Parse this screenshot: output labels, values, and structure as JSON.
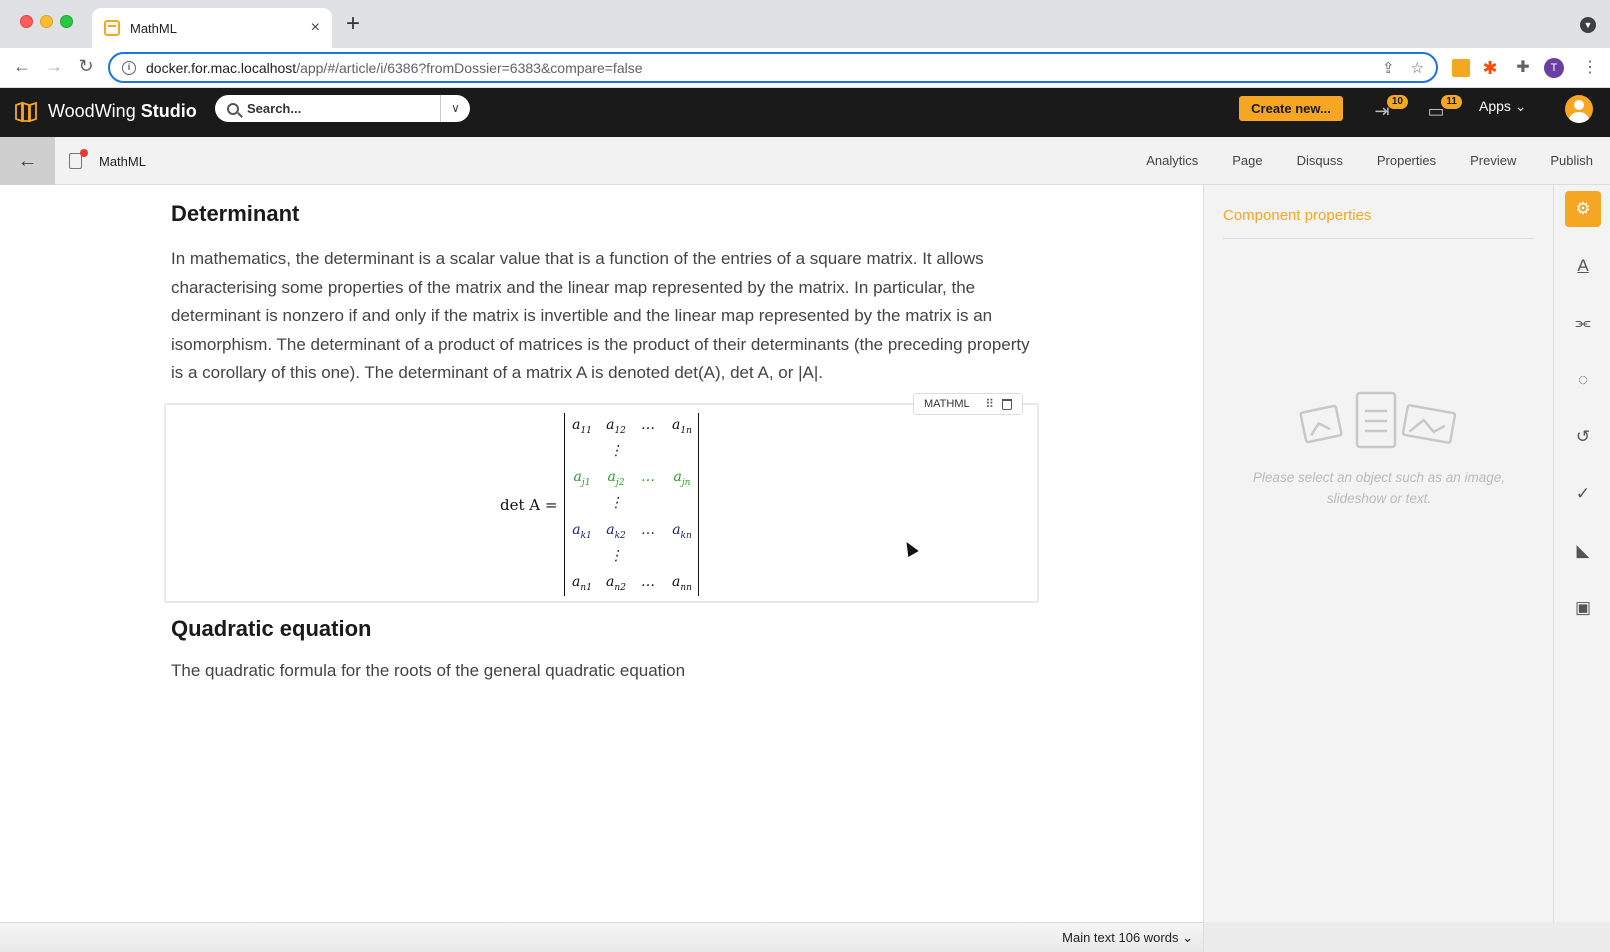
{
  "browser": {
    "tab_title": "MathML",
    "url_host": "docker.for.mac.localhost",
    "url_path": "/app/#/article/i/6386?fromDossier=6383&compare=false",
    "profile_initial": "T"
  },
  "app": {
    "brand_regular": "WoodWing",
    "brand_bold": "Studio",
    "search_placeholder": "Search...",
    "create_label": "Create new...",
    "export_count": "10",
    "inbox_count": "11",
    "apps_label": "Apps"
  },
  "subheader": {
    "doc_name": "MathML",
    "tabs": [
      "Analytics",
      "Page",
      "Disquss",
      "Properties",
      "Preview",
      "Publish"
    ]
  },
  "article": {
    "heading1": "Determinant",
    "paragraph1": "In mathematics, the determinant is a scalar value that is a function of the entries of a square matrix. It allows characterising some properties of the matrix and the linear map represented by the matrix. In particular, the determinant is nonzero if and only if the matrix is invertible and the linear map represented by the matrix is an isomorphism. The determinant of a product of matrices is the product of their determinants (the preceding property is a corollary of this one). The determinant of a matrix A is denoted det(A), det A, or |A|.",
    "math_component_label": "MATHML",
    "math_lhs": "det A =",
    "matrix": {
      "rows": [
        {
          "cells": [
            [
              "a",
              "11"
            ],
            [
              "a",
              "12"
            ],
            [
              "…",
              ""
            ],
            [
              "a",
              "1n"
            ]
          ],
          "color": "#111111"
        },
        {
          "cells": [
            [
              "",
              ""
            ],
            [
              "⋮",
              ""
            ],
            [
              "",
              ""
            ],
            [
              "",
              ""
            ]
          ],
          "color": "#111111"
        },
        {
          "cells": [
            [
              "a",
              "j1"
            ],
            [
              "a",
              "j2"
            ],
            [
              "…",
              ""
            ],
            [
              "a",
              "jn"
            ]
          ],
          "color": "#2e9e2e"
        },
        {
          "cells": [
            [
              "",
              ""
            ],
            [
              "⋮",
              ""
            ],
            [
              "",
              ""
            ],
            [
              "",
              ""
            ]
          ],
          "color": "#111111"
        },
        {
          "cells": [
            [
              "a",
              "k1"
            ],
            [
              "a",
              "k2"
            ],
            [
              "…",
              ""
            ],
            [
              "a",
              "kn"
            ]
          ],
          "color": "#1a237e"
        },
        {
          "cells": [
            [
              "",
              ""
            ],
            [
              "⋮",
              ""
            ],
            [
              "",
              ""
            ],
            [
              "",
              ""
            ]
          ],
          "color": "#111111"
        },
        {
          "cells": [
            [
              "a",
              "n1"
            ],
            [
              "a",
              "n2"
            ],
            [
              "…",
              ""
            ],
            [
              "a",
              "nn"
            ]
          ],
          "color": "#111111"
        }
      ]
    },
    "heading2": "Quadratic equation",
    "paragraph2": "The quadratic formula for the roots of the general quadratic equation"
  },
  "panel": {
    "title": "Component properties",
    "empty_text": "Please select an object such as an image, slideshow or text."
  },
  "rail": {
    "icons": [
      "gear-icon",
      "typography-icon",
      "paperclip-icon",
      "comment-icon",
      "history-icon",
      "check-icon",
      "ai-icon",
      "text-box-icon"
    ]
  },
  "status": {
    "word_count": "Main text 106 words"
  },
  "colors": {
    "accent": "#f5a623",
    "appbar": "#1a1a1a",
    "matrix_green": "#2e9e2e",
    "matrix_blue": "#1a237e"
  }
}
